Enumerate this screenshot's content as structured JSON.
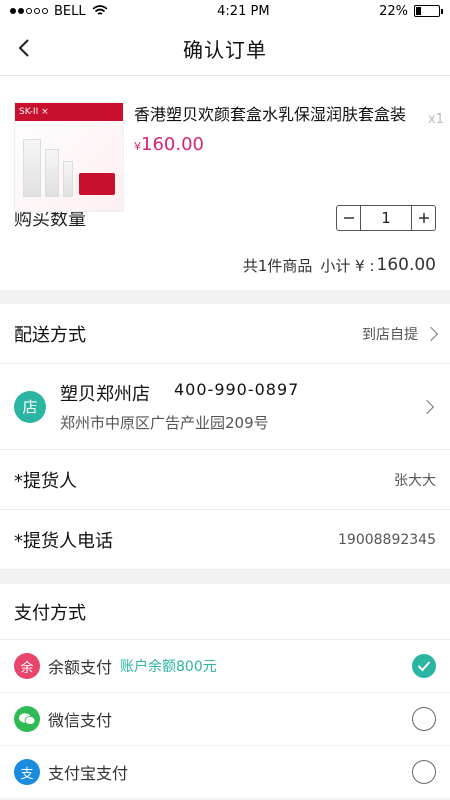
{
  "status_bar": {
    "carrier": "BELL",
    "time": "4:21 PM",
    "battery": "22%",
    "battery_level": 0.22
  },
  "nav": {
    "title": "确认订单"
  },
  "product": {
    "name": "香港塑贝欢颜套盒水乳保湿润肤套盒装",
    "price_symbol": "¥",
    "price": "160.00",
    "qty": "x1",
    "image_banner": "SK-II ×"
  },
  "buy": {
    "label": "购买数量",
    "quantity": "1"
  },
  "subtotal": {
    "count_text": "共1件商品",
    "label": "小计 ¥ :",
    "amount": "160.00"
  },
  "delivery": {
    "label": "配送方式",
    "value": "到店自提"
  },
  "store": {
    "icon_char": "店",
    "name": "塑贝郑州店",
    "phone": "400-990-0897",
    "address": "郑州市中原区广告产业园209号"
  },
  "pickup_person": {
    "label": "*提货人",
    "value": "张大大"
  },
  "pickup_phone": {
    "label": "*提货人电话",
    "value": "19008892345"
  },
  "payment": {
    "title": "支付方式",
    "methods": [
      {
        "icon_char": "余",
        "icon_color": "#e8456b",
        "label": "余额支付",
        "note": "账户余额800元",
        "selected": true
      },
      {
        "icon_char": "微",
        "icon_color": "#2dbb55",
        "label": "微信支付",
        "note": "",
        "selected": false
      },
      {
        "icon_char": "支",
        "icon_color": "#1b8bde",
        "label": "支付宝支付",
        "note": "",
        "selected": false
      }
    ]
  },
  "colors": {
    "accent": "#2bb5a3",
    "price": "#d8237a"
  }
}
